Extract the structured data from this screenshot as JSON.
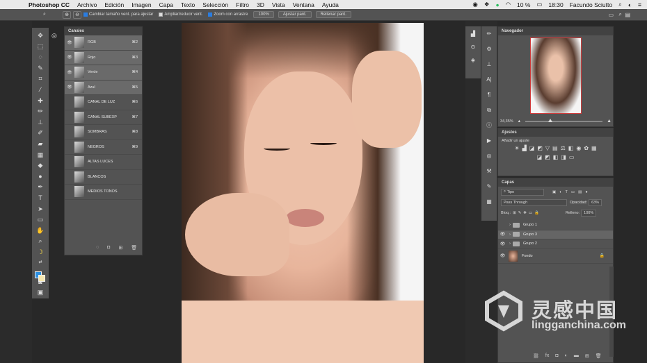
{
  "menubar": {
    "app": "Photoshop CC",
    "items": [
      "Archivo",
      "Edición",
      "Imagen",
      "Capa",
      "Texto",
      "Selección",
      "Filtro",
      "3D",
      "Vista",
      "Ventana",
      "Ayuda"
    ],
    "battery": "10 %",
    "time": "18:30",
    "user": "Facundo Sciutto"
  },
  "options": {
    "resize": "Cambiar tamaño vent. para ajustar",
    "zoom_all": "Ampliar/reducir vent.",
    "scrubby": "Zoom con arrastre",
    "zoom_pct": "100%",
    "fit": "Ajustar pant.",
    "fill": "Rellenar pant."
  },
  "channels": {
    "title": "Canales",
    "rows": [
      {
        "name": "RGB",
        "sc": "⌘2",
        "eye": true
      },
      {
        "name": "Rojo",
        "sc": "⌘3",
        "eye": true
      },
      {
        "name": "Verde",
        "sc": "⌘4",
        "eye": true
      },
      {
        "name": "Azul",
        "sc": "⌘5",
        "eye": true
      },
      {
        "name": "CANAL DE LUZ",
        "sc": "⌘6",
        "eye": false
      },
      {
        "name": "CANAL SUBEXP",
        "sc": "⌘7",
        "eye": false
      },
      {
        "name": "SOMBRAS",
        "sc": "⌘8",
        "eye": false
      },
      {
        "name": "NEGROS",
        "sc": "⌘9",
        "eye": false
      },
      {
        "name": "ALTAS LUCES",
        "sc": "",
        "eye": false
      },
      {
        "name": "BLANCOS",
        "sc": "",
        "eye": false
      },
      {
        "name": "MEDIOS TONOS",
        "sc": "",
        "eye": false
      }
    ]
  },
  "navigator": {
    "title": "Navegador",
    "zoom": "34,35%"
  },
  "adjustments": {
    "title": "Ajustes",
    "subtitle": "Añadir un ajuste"
  },
  "layers": {
    "title": "Capas",
    "filter": "Tipo",
    "blend": "Pass Through",
    "opacity_label": "Opacidad:",
    "opacity": "63%",
    "lock_label": "Bloq.:",
    "fill_label": "Relleno:",
    "fill": "100%",
    "rows": [
      {
        "name": "Grupo 1",
        "eye": false
      },
      {
        "name": "Grupo 3",
        "eye": true
      },
      {
        "name": "Grupo 2",
        "eye": true
      }
    ],
    "background": "Fondo"
  },
  "watermark": {
    "cn": "灵感中国",
    "en": "lingganchina.com"
  }
}
